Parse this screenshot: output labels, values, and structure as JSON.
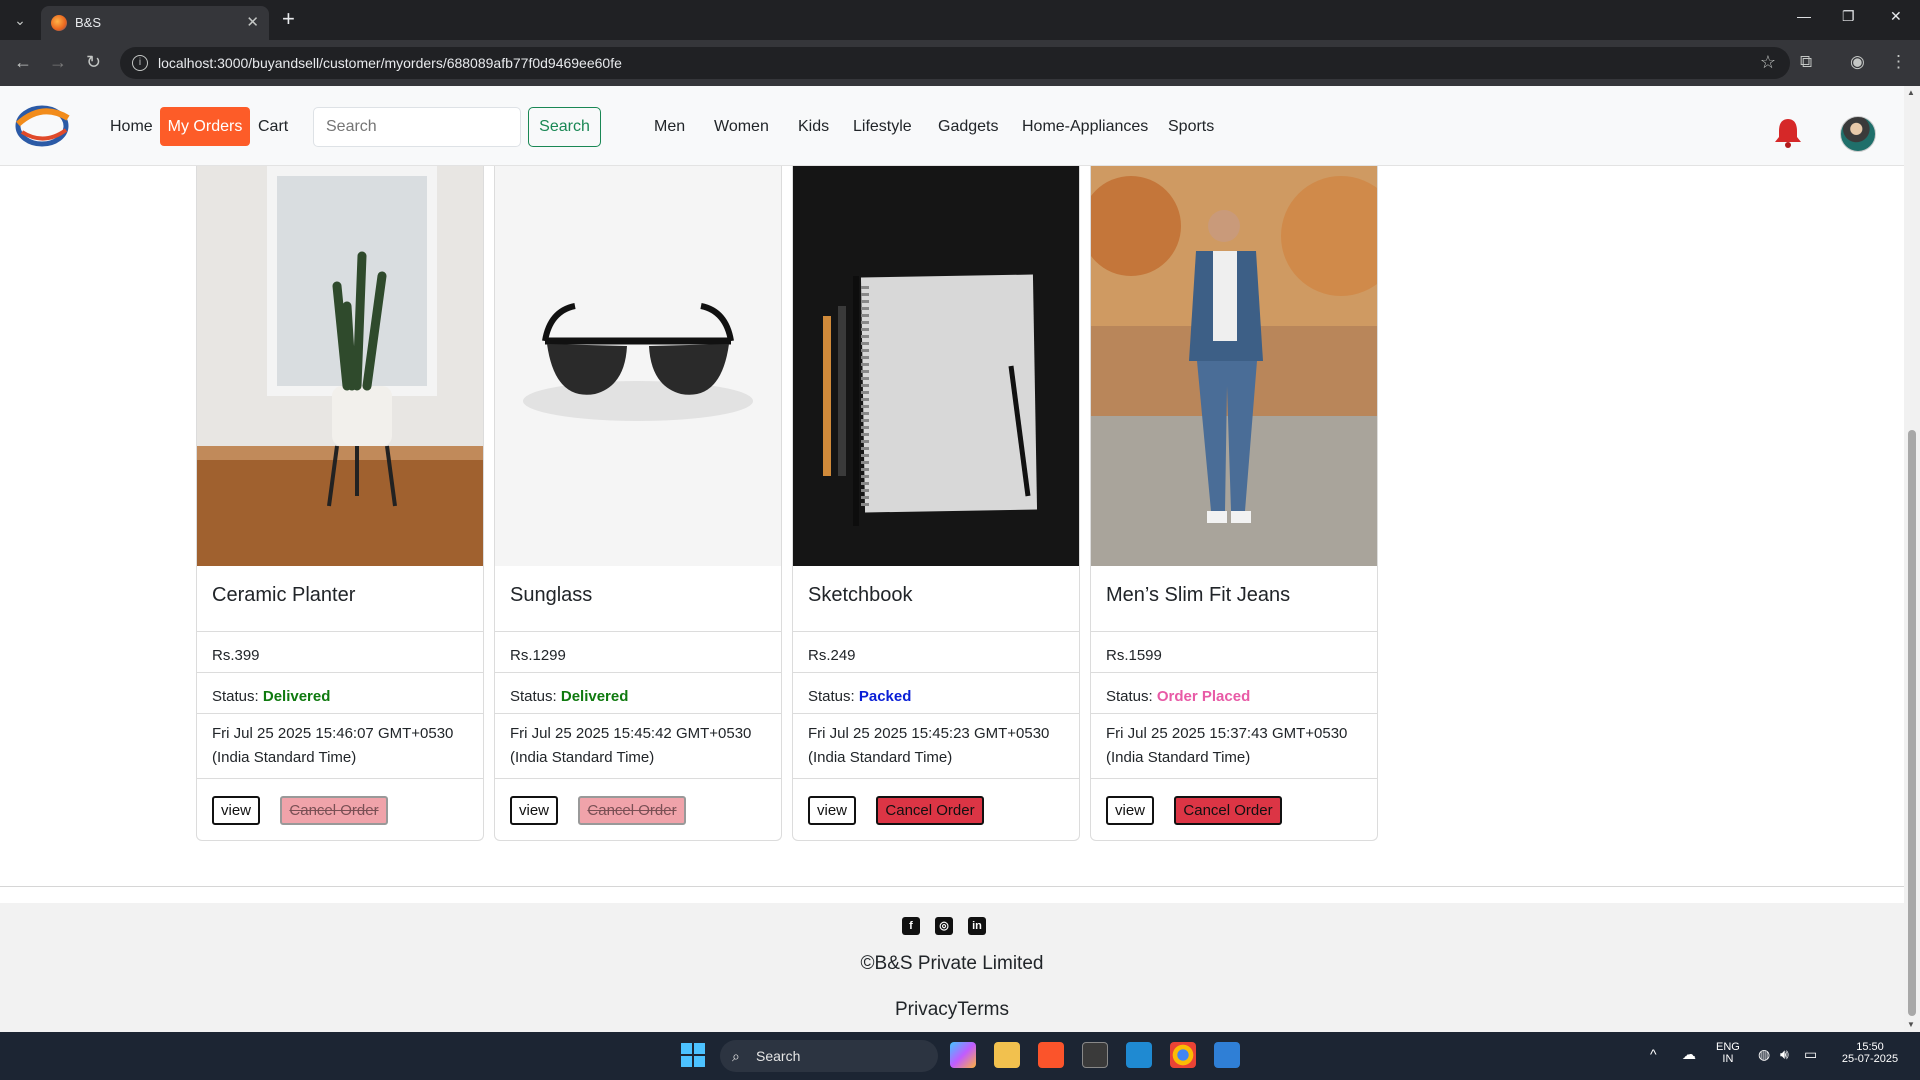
{
  "browser": {
    "tab_title": "B&S",
    "url": "localhost:3000/buyandsell/customer/myorders/688089afb77f0d9469ee60fe"
  },
  "navbar": {
    "home": "Home",
    "my_orders": "My Orders",
    "cart": "Cart",
    "search_placeholder": "Search",
    "search_button": "Search",
    "categories": [
      "Men",
      "Women",
      "Kids",
      "Lifestyle",
      "Gadgets",
      "Home-Appliances",
      "Sports"
    ]
  },
  "orders": [
    {
      "title": "Ceramic Planter",
      "price": "Rs.399",
      "status_label": "Status: ",
      "status": "Delivered",
      "date_line1": "Fri Jul 25 2025 15:46:07 GMT+0530",
      "date_line2": "(India Standard Time)",
      "view": "view",
      "cancel": "Cancel Order",
      "cancel_disabled": true
    },
    {
      "title": "Sunglass",
      "price": "Rs.1299",
      "status_label": "Status: ",
      "status": "Delivered",
      "date_line1": "Fri Jul 25 2025 15:45:42 GMT+0530",
      "date_line2": "(India Standard Time)",
      "view": "view",
      "cancel": "Cancel Order",
      "cancel_disabled": true
    },
    {
      "title": "Sketchbook",
      "price": "Rs.249",
      "status_label": "Status: ",
      "status": "Packed",
      "date_line1": "Fri Jul 25 2025 15:45:23 GMT+0530",
      "date_line2": "(India Standard Time)",
      "view": "view",
      "cancel": "Cancel Order",
      "cancel_disabled": false
    },
    {
      "title": "Men’s Slim Fit Jeans",
      "price": "Rs.1599",
      "status_label": "Status: ",
      "status": "Order Placed",
      "date_line1": "Fri Jul 25 2025 15:37:43 GMT+0530",
      "date_line2": "(India Standard Time)",
      "view": "view",
      "cancel": "Cancel Order",
      "cancel_disabled": false
    }
  ],
  "footer": {
    "copyright": "©B&S Private Limited",
    "links": "PrivacyTerms",
    "social_icons": [
      "facebook-icon",
      "instagram-icon",
      "linkedin-icon"
    ]
  },
  "taskbar": {
    "search": "Search",
    "lang_line1": "ENG",
    "lang_line2": "IN",
    "time": "15:50",
    "date": "25-07-2025"
  },
  "colors": {
    "accent": "#fd5c28",
    "delivered": "#0f7a0f",
    "packed": "#0a1fd6",
    "order_placed": "#e85aa6",
    "cancel": "#dc3545"
  }
}
